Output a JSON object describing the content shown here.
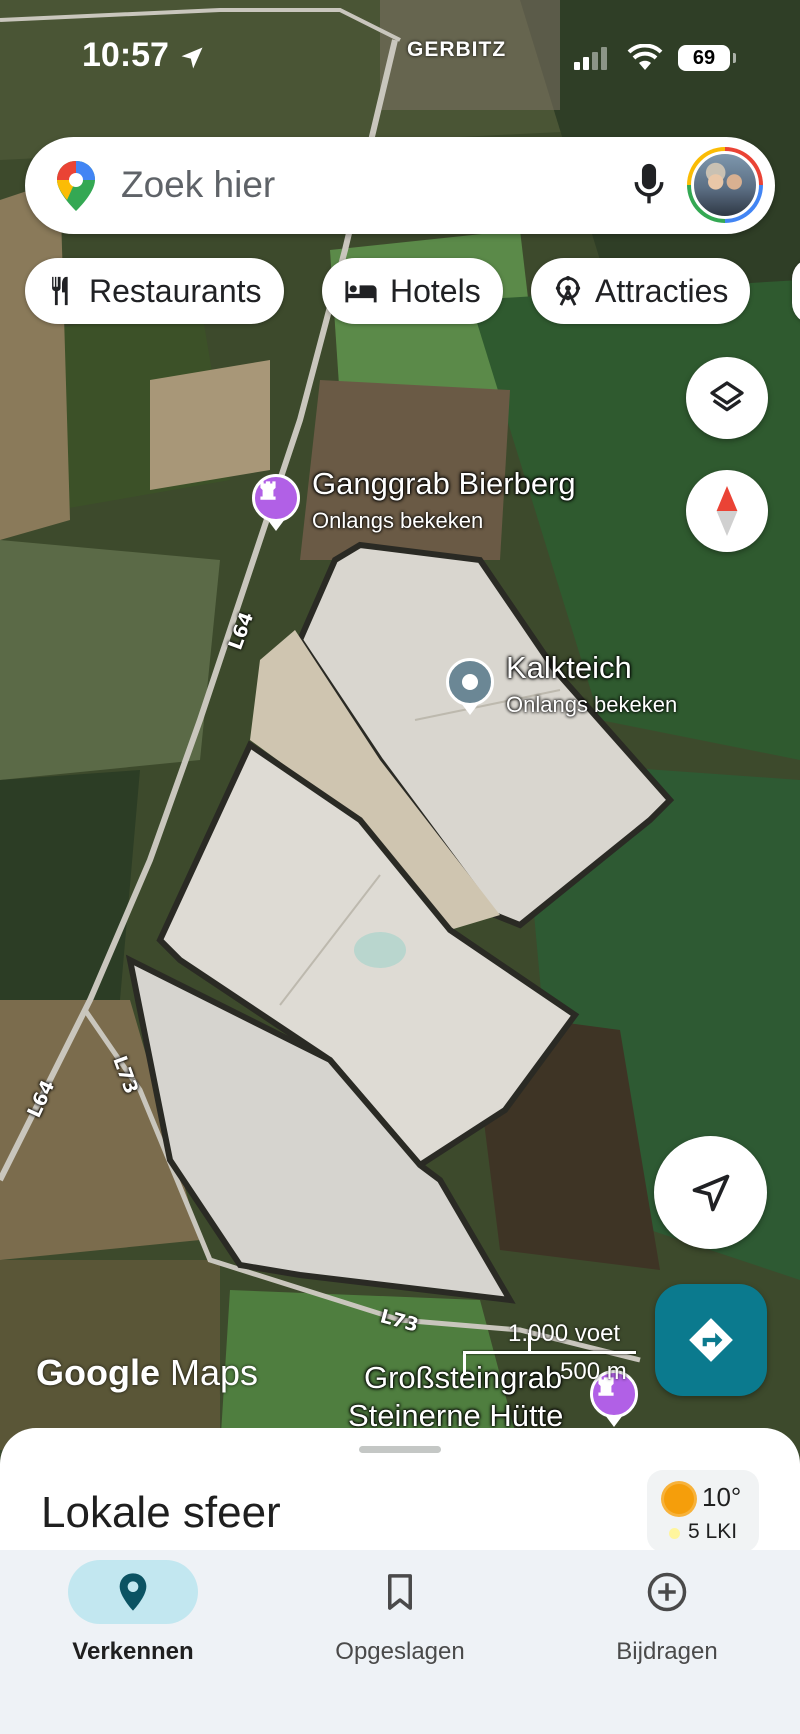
{
  "status_bar": {
    "time": "10:57",
    "town": "GERBITZ",
    "battery": "69"
  },
  "search": {
    "placeholder": "Zoek hier"
  },
  "chips": [
    {
      "label": "Restaurants",
      "icon": "fork-knife-icon"
    },
    {
      "label": "Hotels",
      "icon": "bed-icon"
    },
    {
      "label": "Attracties",
      "icon": "ferris-wheel-icon"
    }
  ],
  "map": {
    "places": [
      {
        "name": "Ganggrab Bierberg",
        "sub": "Onlangs bekeken"
      },
      {
        "name": "Kalkteich",
        "sub": "Onlangs bekeken"
      },
      {
        "name": "Großsteingrab",
        "name2": "Steinerne Hütte"
      }
    ],
    "roads": [
      "L64",
      "L73",
      "L64",
      "L73"
    ],
    "scale": {
      "feet": "1.000 voet",
      "meters": "500 m"
    },
    "logo": {
      "google": "Google",
      "maps": "Maps"
    }
  },
  "sheet": {
    "title": "Lokale sfeer",
    "weather": {
      "temp": "10°",
      "air_quality": "5 LKI"
    }
  },
  "nav": [
    {
      "label": "Verkennen",
      "active": true
    },
    {
      "label": "Opgeslagen",
      "active": false
    },
    {
      "label": "Bijdragen",
      "active": false
    }
  ],
  "colors": {
    "accent": "#0b7a8e",
    "active_nav_bg": "#c2e7f0",
    "place_pin": "#b160e6",
    "nav_bg": "#eef2f6"
  }
}
